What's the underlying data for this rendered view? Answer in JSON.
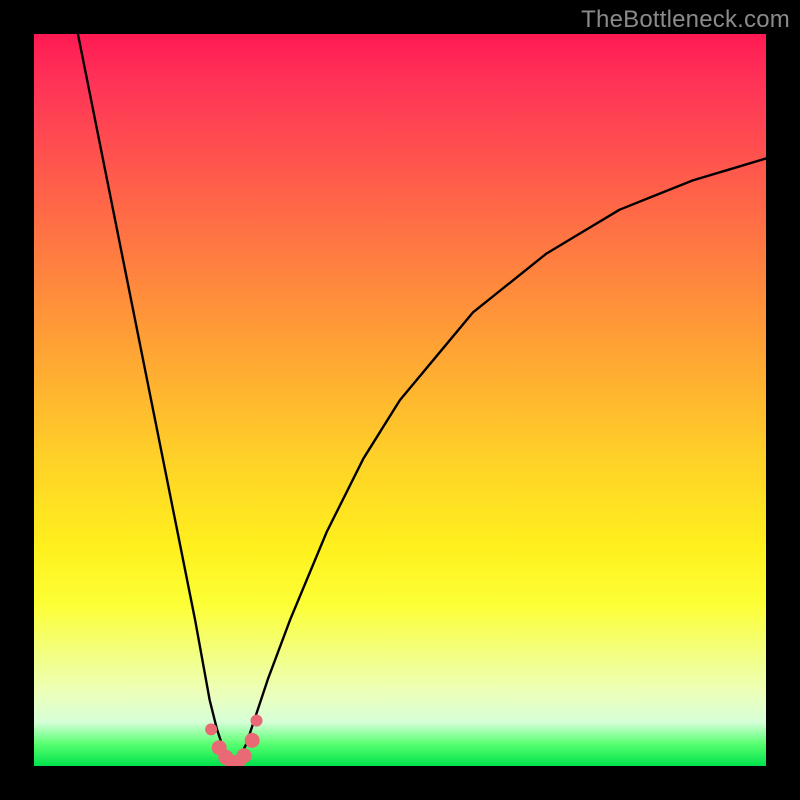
{
  "watermark": "TheBottleneck.com",
  "chart_data": {
    "type": "line",
    "title": "",
    "xlabel": "",
    "ylabel": "",
    "xlim": [
      0,
      100
    ],
    "ylim": [
      0,
      100
    ],
    "grid": false,
    "note": "V-shaped curve over rainbow gradient; minimum near x≈27 at y≈0. Y axis interpretable as bottleneck percentage, small cluster of highlighted points near trough.",
    "series": [
      {
        "name": "curve",
        "x": [
          6,
          8,
          10,
          12,
          14,
          16,
          18,
          20,
          22,
          24,
          25,
          26,
          27,
          28,
          29,
          30,
          32,
          35,
          40,
          45,
          50,
          55,
          60,
          65,
          70,
          75,
          80,
          85,
          90,
          95,
          100
        ],
        "y": [
          100,
          90,
          80,
          70,
          60,
          50,
          40,
          30,
          20,
          9,
          5,
          2,
          0,
          1,
          3,
          6,
          12,
          20,
          32,
          42,
          50,
          56,
          62,
          66,
          70,
          73,
          76,
          78,
          80,
          81.5,
          83
        ]
      }
    ],
    "highlight_points": {
      "x": [
        24.2,
        25.3,
        26.2,
        27.0,
        27.8,
        28.7,
        29.8,
        30.4
      ],
      "y": [
        5.0,
        2.5,
        1.2,
        0.5,
        0.5,
        1.4,
        3.5,
        6.2
      ]
    },
    "background_gradient": {
      "top_color": "#ff1a52",
      "bottom_color": "#00e24b"
    }
  }
}
